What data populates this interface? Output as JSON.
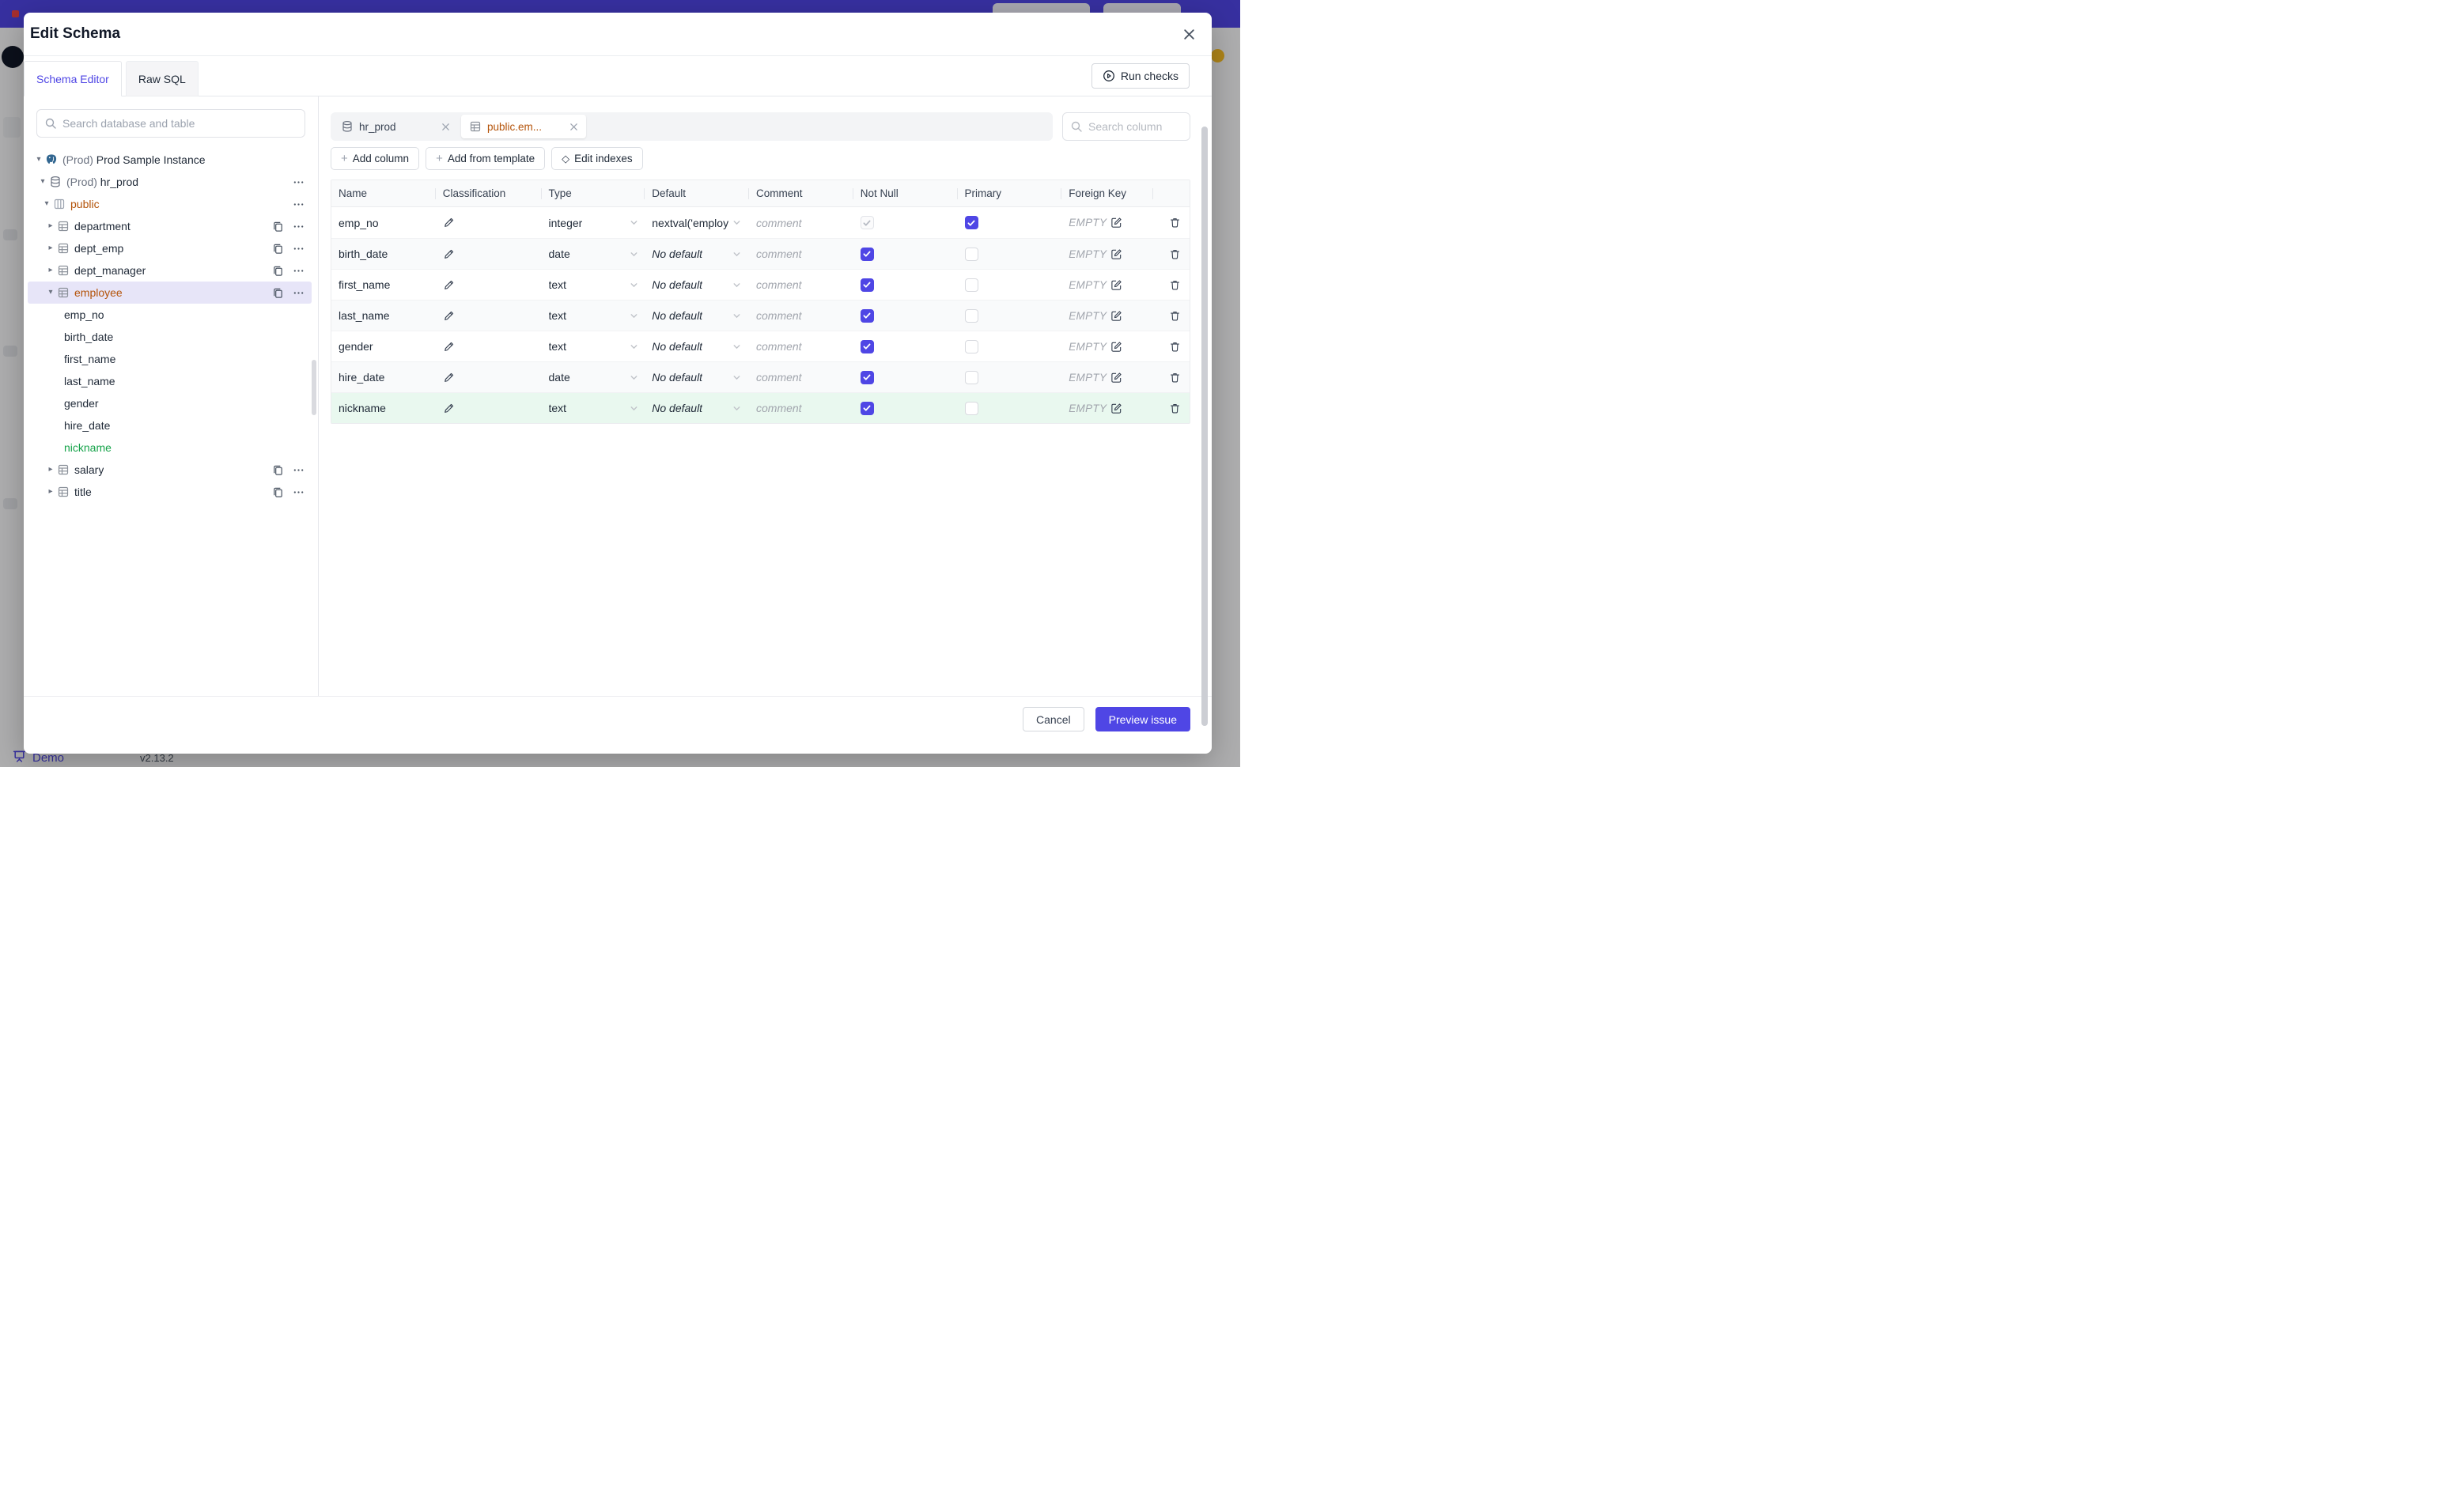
{
  "page": {
    "topbar_color": "#4f46e5",
    "brand": {
      "label": "Demo",
      "version": "v2.13.2"
    }
  },
  "modal": {
    "title": "Edit Schema",
    "tabs": [
      {
        "label": "Schema Editor",
        "active": true
      },
      {
        "label": "Raw SQL",
        "active": false
      }
    ],
    "run_checks_label": "Run checks",
    "footer": {
      "cancel_label": "Cancel",
      "submit_label": "Preview issue"
    }
  },
  "sidebar": {
    "search_placeholder": "Search database and table",
    "tree": [
      {
        "prefix": "(Prod)",
        "label": "Prod Sample Instance",
        "icon": "postgres-icon",
        "caret": "down",
        "level": 0,
        "actions": []
      },
      {
        "prefix": "(Prod)",
        "label": "hr_prod",
        "icon": "database-icon",
        "caret": "down",
        "level": 1,
        "actions": [
          "more"
        ]
      },
      {
        "label": "public",
        "icon": "schema-icon",
        "caret": "down",
        "level": 2,
        "color": "amber",
        "actions": [
          "more"
        ]
      },
      {
        "label": "department",
        "icon": "table-icon",
        "caret": "right",
        "level": 3,
        "actions": [
          "copy",
          "more"
        ]
      },
      {
        "label": "dept_emp",
        "icon": "table-icon",
        "caret": "right",
        "level": 3,
        "actions": [
          "copy",
          "more"
        ]
      },
      {
        "label": "dept_manager",
        "icon": "table-icon",
        "caret": "right",
        "level": 3,
        "actions": [
          "copy",
          "more"
        ]
      },
      {
        "label": "employee",
        "icon": "table-icon",
        "caret": "down",
        "level": 3,
        "color": "amber",
        "selected": true,
        "actions": [
          "copy",
          "more"
        ]
      },
      {
        "label": "emp_no",
        "column": true
      },
      {
        "label": "birth_date",
        "column": true
      },
      {
        "label": "first_name",
        "column": true
      },
      {
        "label": "last_name",
        "column": true
      },
      {
        "label": "gender",
        "column": true
      },
      {
        "label": "hire_date",
        "column": true
      },
      {
        "label": "nickname",
        "column": true,
        "color": "green"
      },
      {
        "label": "salary",
        "icon": "table-icon",
        "caret": "right",
        "level": 3,
        "actions": [
          "copy",
          "more"
        ]
      },
      {
        "label": "title",
        "icon": "table-icon",
        "caret": "right",
        "level": 3,
        "actions": [
          "copy",
          "more"
        ]
      }
    ]
  },
  "editor": {
    "open_tabs": [
      {
        "label": "hr_prod",
        "icon": "database-icon",
        "active": false
      },
      {
        "label": "public.em...",
        "icon": "table-icon",
        "active": true,
        "color": "amber"
      }
    ],
    "search_placeholder": "Search column",
    "toolbar": {
      "add_column": "Add column",
      "add_from_template": "Add from template",
      "edit_indexes": "Edit indexes"
    },
    "table": {
      "headers": [
        "Name",
        "Classification",
        "Type",
        "Default",
        "Comment",
        "Not Null",
        "Primary",
        "Foreign Key"
      ],
      "comment_placeholder": "comment",
      "foreign_key_empty": "EMPTY",
      "rows": [
        {
          "name": "emp_no",
          "type": "integer",
          "default": "nextval('employ",
          "default_is_set": true,
          "not_null": true,
          "not_null_disabled": true,
          "primary": true
        },
        {
          "name": "birth_date",
          "type": "date",
          "default": "No default",
          "default_is_set": false,
          "not_null": true,
          "primary": false
        },
        {
          "name": "first_name",
          "type": "text",
          "default": "No default",
          "default_is_set": false,
          "not_null": true,
          "primary": false
        },
        {
          "name": "last_name",
          "type": "text",
          "default": "No default",
          "default_is_set": false,
          "not_null": true,
          "primary": false
        },
        {
          "name": "gender",
          "type": "text",
          "default": "No default",
          "default_is_set": false,
          "not_null": true,
          "primary": false
        },
        {
          "name": "hire_date",
          "type": "date",
          "default": "No default",
          "default_is_set": false,
          "not_null": true,
          "primary": false
        },
        {
          "name": "nickname",
          "type": "text",
          "default": "No default",
          "default_is_set": false,
          "not_null": true,
          "primary": false,
          "highlight": "green"
        }
      ]
    }
  },
  "colors": {
    "accent": "#4f46e5",
    "amber": "#b45309",
    "green": "#16a34a",
    "selected_tree_bg": "#e7e5f8",
    "new_column_bg": "#e9f8ef"
  }
}
